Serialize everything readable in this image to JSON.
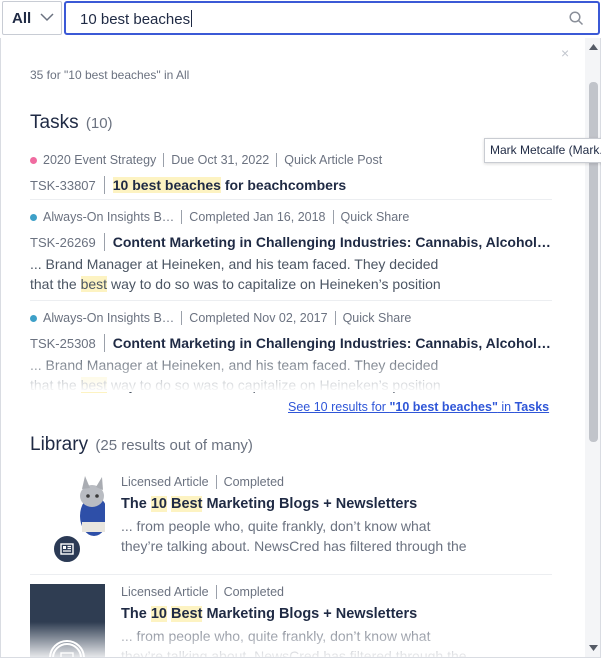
{
  "search": {
    "scope_label": "All",
    "query": "10 best beaches"
  },
  "panel": {
    "summary": "35 for \"10 best beaches\" in All",
    "close_icon": "×"
  },
  "tasks_section": {
    "title": "Tasks",
    "count": "(10)",
    "items": [
      {
        "dot_color": "#f06ba0",
        "project": "2020 Event Strategy",
        "status": "Due Oct 31, 2022",
        "type": "Quick Article Post",
        "id": "TSK-33807",
        "title_highlight": "10 best beaches",
        "title_rest": " for beachcombers"
      },
      {
        "dot_color": "#3ea0c8",
        "project": "Always-On Insights B…",
        "status": "Completed Jan 16, 2018",
        "type": "Quick Share",
        "id": "TSK-26269",
        "title": "Content Marketing in Challenging Industries: Cannabis, Alcohol…",
        "excerpt_line1": "... Brand Manager at Heineken, and his team faced. They decided",
        "excerpt_line2_pre": "that the ",
        "excerpt_line2_hl": "best",
        "excerpt_line2_post": " way to do so was to capitalize on Heineken’s position"
      },
      {
        "dot_color": "#3ea0c8",
        "project": "Always-On Insights B…",
        "status": "Completed Nov 02, 2017",
        "type": "Quick Share",
        "id": "TSK-25308",
        "title": "Content Marketing in Challenging Industries: Cannabis, Alcohol…",
        "excerpt_line1": "... Brand Manager at Heineken, and his team faced. They decided",
        "excerpt_line2_pre": "that the ",
        "excerpt_line2_hl": "best",
        "excerpt_line2_post": " way to do so was to capitalize on Heineken’s position"
      }
    ],
    "see_all_pre": "See 10 results for ",
    "see_all_query": "\"10 best beaches\"",
    "see_all_mid": " in ",
    "see_all_scope": "Tasks"
  },
  "library_section": {
    "title": "Library",
    "count": "(25 results out of many)",
    "items": [
      {
        "type": "Licensed Article",
        "status": "Completed",
        "title_pre": "The ",
        "title_hl1": "10",
        "title_sp": " ",
        "title_hl2": "Best",
        "title_post": " Marketing Blogs + Newsletters",
        "excerpt_line1": "... from people who, quite frankly, don’t know what",
        "excerpt_line2": "they’re talking about. NewsCred has filtered through the",
        "thumb": "cat-photo",
        "badge_icon": "article-icon"
      },
      {
        "type": "Licensed Article",
        "status": "Completed",
        "title_pre": "The ",
        "title_hl1": "10",
        "title_sp": " ",
        "title_hl2": "Best",
        "title_post": " Marketing Blogs + Newsletters",
        "excerpt_line1": "... from people who, quite frankly, don’t know what",
        "excerpt_line2": "they’re talking about. NewsCred has filtered through the",
        "thumb": "placeholder",
        "badge_icon": "article-icon"
      }
    ]
  },
  "tooltip": {
    "text": "Mark Metcalfe (Mark..."
  },
  "colors": {
    "accent": "#3b59d6",
    "link": "#2f56d8",
    "highlight": "#fdf3c2",
    "navy": "#2b3a55"
  }
}
